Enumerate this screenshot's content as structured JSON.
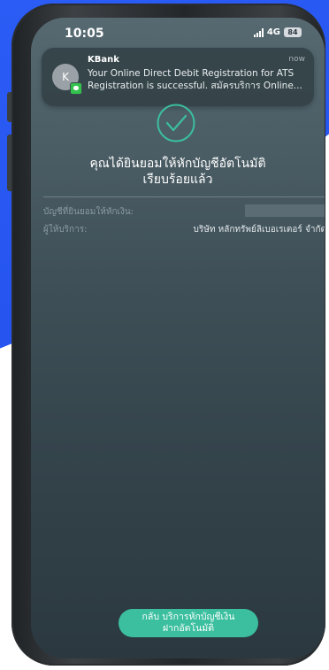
{
  "status_bar": {
    "time": "10:05",
    "network": "4G",
    "battery": "84"
  },
  "notification": {
    "avatar_initial": "K",
    "app": "KBank",
    "time": "now",
    "message": "Your Online Direct Debit Registration for ATS Registration is successful. สมัครบริการ Online..."
  },
  "success": {
    "icon": "check-circle-icon",
    "title_line1": "คุณได้ยินยอมให้หักบัญชีอัตโนมัติ",
    "title_line2": "เรียบร้อยแล้ว"
  },
  "details": {
    "account_label": "บัญชีที่ยินยอมให้หักเงิน:",
    "provider_label": "ผู้ให้บริการ:",
    "provider_value": "บริษัท หลักทรัพย์ลิเบอเรเตอร์ จำกัด"
  },
  "cta": {
    "line1": "กลับ บริการหักบัญชีเงิน",
    "line2": "ฝากอัตโนมัติ"
  },
  "colors": {
    "accent": "#3bbf9f",
    "background_blue": "#2b5cf5"
  }
}
